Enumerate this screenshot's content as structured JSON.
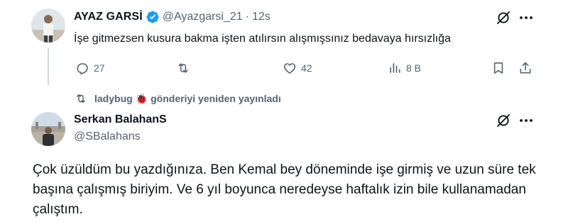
{
  "tweet1": {
    "name": "AYAZ GARSİ",
    "handle": "@Ayazgarsi_21",
    "separator": "·",
    "time": "12s",
    "text": "İşe gitmezsen kusura bakma işten atılırsın alışmışsınız bedavaya hırsızlığa",
    "actions": {
      "reply_count": "27",
      "repost_count": "",
      "like_count": "42",
      "views_count": "8 B"
    }
  },
  "retweet": {
    "user": "ladybug",
    "emoji": "🐞",
    "text": "gönderiyi yeniden yayınladı"
  },
  "tweet2": {
    "name": "Serkan BalahanS",
    "handle": "@SBalahans",
    "text": "Çok üzüldüm bu yazdığınıza. Ben Kemal bey döneminde işe girmiş ve uzun süre tek başına çalışmış biriyim. Ve 6 yıl boyunca neredeyse haftalık izin bile kullanamadan çalıştım."
  },
  "icons": {
    "verified": "verified-badge-icon",
    "grok": "grok-icon",
    "more": "more-icon",
    "reply": "reply-icon",
    "repost": "repost-icon",
    "like": "like-icon",
    "views": "views-icon",
    "bookmark": "bookmark-icon",
    "share": "share-icon"
  },
  "colors": {
    "text": "#0f1419",
    "muted": "#536471",
    "verified": "#1d9bf0",
    "thread_line": "#cfd9de"
  }
}
